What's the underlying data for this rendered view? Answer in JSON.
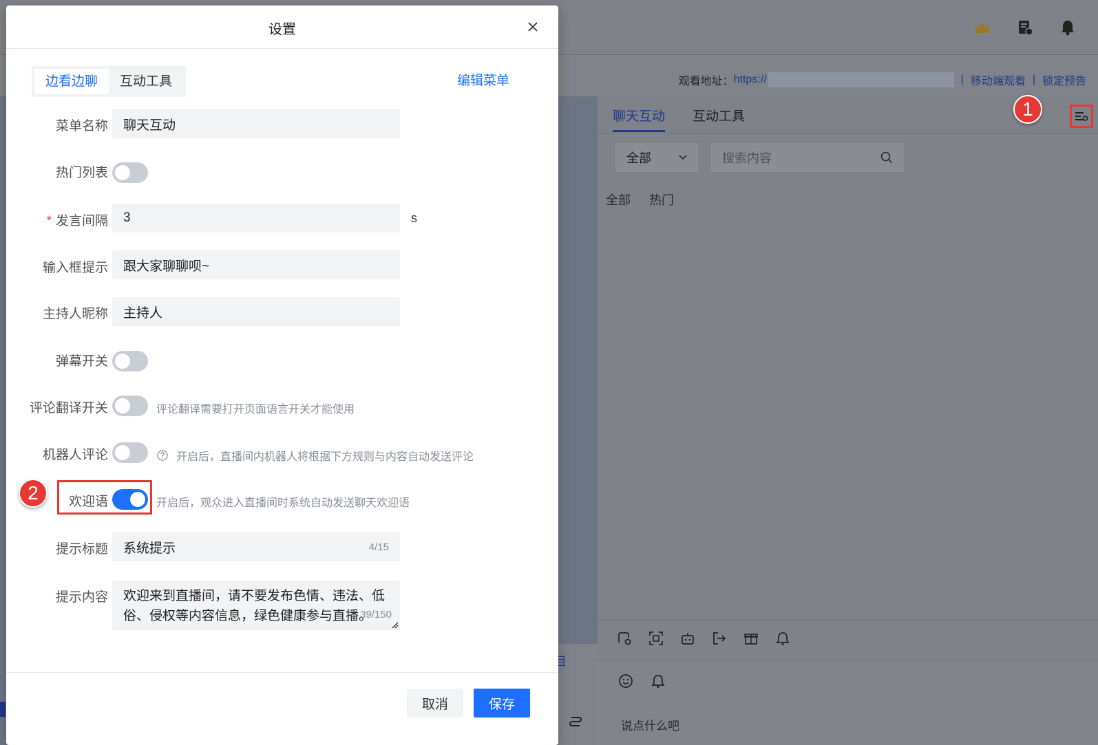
{
  "background": {
    "watch_label": "观看地址：",
    "watch_url": "https://",
    "mobile_watch": "移动端观看",
    "lock_preview": "锁定预告",
    "panel_tabs": [
      "聊天互动",
      "互动工具"
    ],
    "filter_select": "全部",
    "search_placeholder": "搜索内容",
    "filters": [
      "全部",
      "热门"
    ],
    "input_placeholder": "说点什么吧",
    "mini_text": "目"
  },
  "annotations": {
    "badge1": "1",
    "badge2": "2"
  },
  "modal": {
    "title": "设置",
    "tabs": [
      "边看边聊",
      "互动工具"
    ],
    "edit_menu": "编辑菜单",
    "fields": {
      "menu_name_label": "菜单名称",
      "menu_name_value": "聊天互动",
      "hot_list_label": "热门列表",
      "interval_required": "*",
      "interval_label": "发言间隔",
      "interval_value": "3",
      "interval_unit": "s",
      "input_hint_label": "输入框提示",
      "input_hint_value": "跟大家聊聊呗~",
      "host_nick_label": "主持人昵称",
      "host_nick_value": "主持人",
      "danmaku_label": "弹幕开关",
      "translate_label": "评论翻译开关",
      "translate_hint": "评论翻译需要打开页面语言开关才能使用",
      "robot_label": "机器人评论",
      "robot_hint": "开启后，直播间内机器人将根据下方规则与内容自动发送评论",
      "welcome_label": "欢迎语",
      "welcome_hint": "开启后，观众进入直播间时系统自动发送聊天欢迎语",
      "tip_title_label": "提示标题",
      "tip_title_value": "系统提示",
      "tip_title_count": "4/15",
      "tip_content_label": "提示内容",
      "tip_content_value": "欢迎来到直播间，请不要发布色情、违法、低俗、侵权等内容信息，绿色健康参与直播。",
      "tip_content_count": "39/150"
    },
    "toggles": {
      "hot_list": false,
      "danmaku": false,
      "translate": false,
      "robot": false,
      "welcome": true
    },
    "cancel": "取消",
    "save": "保存"
  },
  "colors": {
    "primary": "#1e6fff",
    "annotation": "#e53935"
  }
}
